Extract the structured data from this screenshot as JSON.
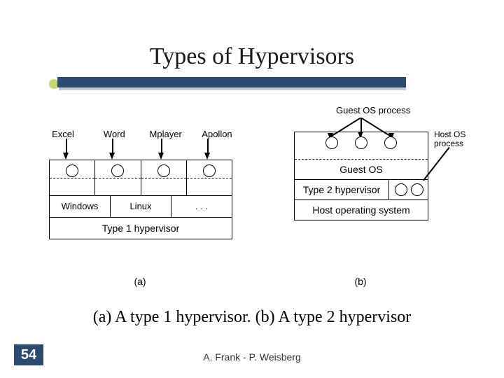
{
  "title": "Types of Hypervisors",
  "caption": "(a) A type 1 hypervisor. (b) A type 2 hypervisor",
  "page_number": "54",
  "footer": "A. Frank - P. Weisberg",
  "fig_a": {
    "apps": [
      "Excel",
      "Word",
      "Mplayer",
      "Apollon"
    ],
    "os": [
      "Windows",
      "Linux",
      ". . ."
    ],
    "hv": "Type 1 hypervisor",
    "label": "(a)"
  },
  "fig_b": {
    "guest_proc_label": "Guest OS process",
    "host_proc_label": "Host OS process",
    "guest_os": "Guest OS",
    "t2": "Type 2 hypervisor",
    "host_os": "Host operating system",
    "label": "(b)"
  }
}
